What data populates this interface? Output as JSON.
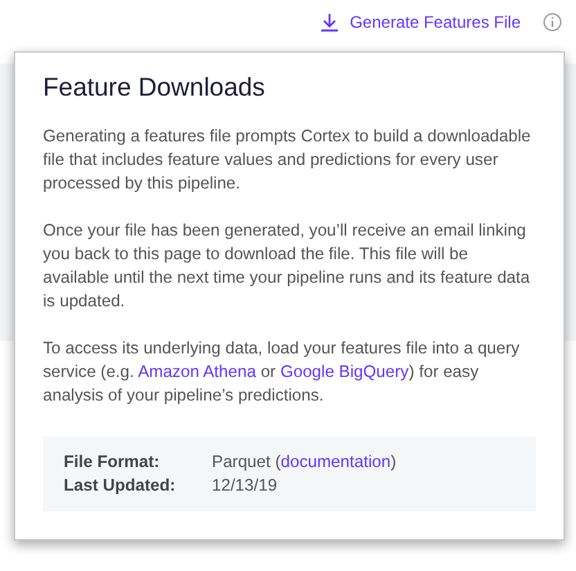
{
  "header": {
    "action": {
      "label": "Generate Features File"
    }
  },
  "popover": {
    "title": "Feature Downloads",
    "paragraphs": [
      [
        {
          "text": "Generating a features file prompts Cortex to build a downloadable file that includes feature values and predictions for every user processed by this pipeline.",
          "link": false
        }
      ],
      [
        {
          "text": "Once your file has been generated, you’ll receive an email linking you back to this page to download the file. This file will be available until the next time your pipeline runs and its feature data is updated.",
          "link": false
        }
      ],
      [
        {
          "text": "To access its underlying data, load your features file into a query service (e.g. ",
          "link": false
        },
        {
          "text": "Amazon Athena",
          "link": true
        },
        {
          "text": " or ",
          "link": false
        },
        {
          "text": "Google BigQuery",
          "link": true
        },
        {
          "text": ") for easy analysis of your pipeline’s predictions.",
          "link": false
        }
      ]
    ],
    "details": [
      {
        "label": "File Format:",
        "value": [
          {
            "text": "Parquet (",
            "link": false
          },
          {
            "text": "documentation",
            "link": true
          },
          {
            "text": ")",
            "link": false
          }
        ]
      },
      {
        "label": "Last Updated:",
        "value": [
          {
            "text": "12/13/19",
            "link": false
          }
        ]
      }
    ]
  }
}
